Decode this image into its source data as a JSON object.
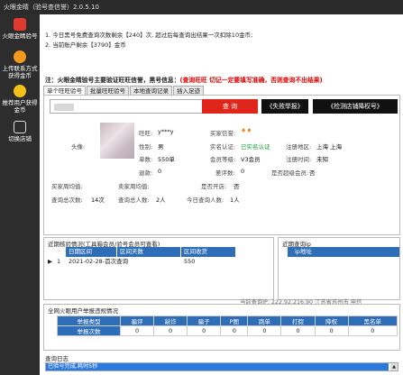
{
  "app": {
    "title": "火眼金睛（验号查信誉）2.0.5.10"
  },
  "sidebar": {
    "items": [
      {
        "label": "火眼金睛验号",
        "icon": "fire-eye-icon"
      },
      {
        "label": "上传联系方式获得金币",
        "icon": "upload-icon"
      },
      {
        "label": "推荐用户获得金币",
        "icon": "face-icon"
      },
      {
        "label": "切换店铺",
        "icon": "door-exit-icon"
      }
    ]
  },
  "notices": {
    "line1": "1. 今日黑号免费查询次数剩余【240】次, 超过后每查询出结果一次扣除10金币;",
    "line2": "2. 当前账户剩余【3790】金币",
    "warning_prefix": "注：火眼金睛验号主要验证旺旺信誉，黑号信息：",
    "warning_red": "(查询旺旺 切记一定要填写准确，否则查询不出结果)"
  },
  "tabs": [
    "单个旺旺验号",
    "批量旺旺验号",
    "本地查询记录",
    "插入足迹"
  ],
  "search": {
    "query_button": "查 询",
    "report_button": "《失败举报》",
    "shop_button": "《检测店铺降权号》"
  },
  "profile": {
    "labels": {
      "wangwang": "旺旺:",
      "gender": "性别:",
      "orders": "单数:",
      "refund": "退款:",
      "avatar": "头像:",
      "buyer_credit": "买家信誉:",
      "real_name": "实名认证:",
      "member_level": "会员等级:",
      "alipay": "当月账单:",
      "reg_location": "注册地区:",
      "reg_time": "注册时间:",
      "black_count": "差评数:",
      "is_super_member": "是否超级会员:",
      "buyer_week": "买家周均值:",
      "seller_week": "卖家周均值:",
      "is_seller": "是否开店:",
      "total_queries": "查询总次数:",
      "total_people": "查询总人数:",
      "today_people": "今日查询人数:"
    },
    "values": {
      "wangwang": "y***y",
      "gender": "男",
      "orders": "550单",
      "refund": "0",
      "buyer_credit_icon": "heart-heart",
      "real_name": "已实名认证",
      "member_level": "V3会员",
      "alipay": "0",
      "reg_location": "上海 上海",
      "reg_time": "未知",
      "black_count": "0",
      "is_super_member": "否",
      "is_seller": "否",
      "total_queries": "14次",
      "total_people": "2人",
      "today_people": "1人"
    }
  },
  "recent_check": {
    "title": "近期核验情况(工具箱会员/验号会员可查看)",
    "columns": [
      "日期区间",
      "区间天数",
      "区间收货"
    ],
    "rows": [
      {
        "index": "1",
        "date": "2021-02-28-首次查询",
        "days": "",
        "received": "550"
      }
    ]
  },
  "recent_query": {
    "title": "近期查询ip",
    "columns": [
      "ip地址"
    ]
  },
  "ip_line": "当前查询IP: 222.92.216.90  江苏省苏州市  电信",
  "report_table": {
    "title": "全网火眼用户举报违规情况",
    "headers": [
      "举报类型",
      "骗评",
      "敲诈",
      "骗子",
      "P图",
      "跑单",
      "打假",
      "降权",
      "黑名单"
    ],
    "row_label": "举报次数",
    "values": [
      "0",
      "0",
      "0",
      "0",
      "0",
      "0",
      "0",
      "0"
    ]
  },
  "log": {
    "label": "查询日志",
    "entry": "已验号完成,耗时5秒"
  }
}
